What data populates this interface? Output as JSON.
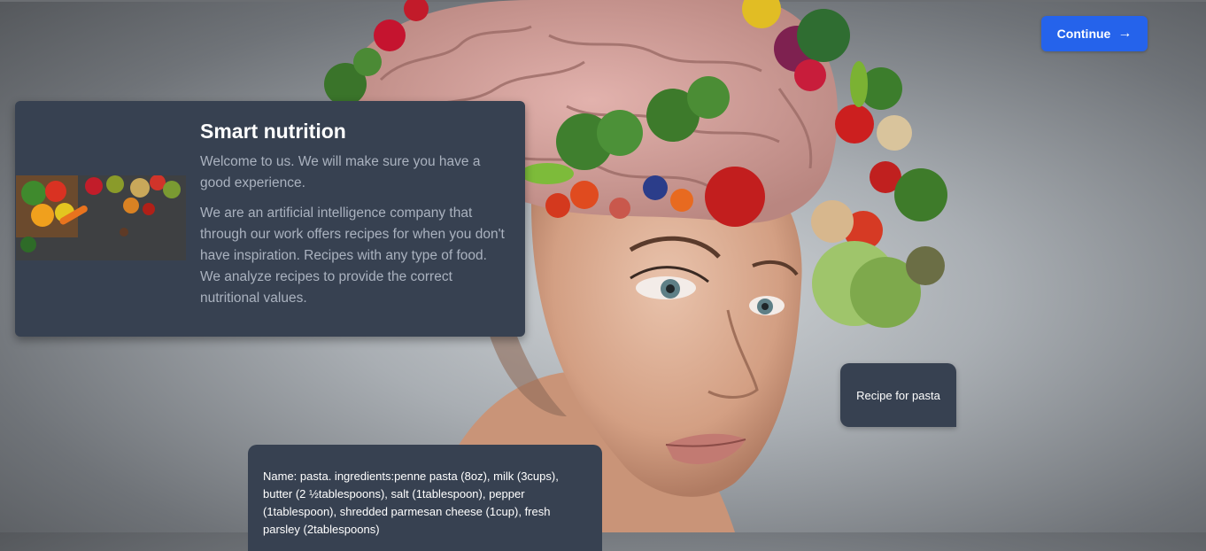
{
  "header": {
    "continue_label": "Continue",
    "continue_icon": "arrow-right-icon"
  },
  "intro": {
    "title": "Smart nutrition",
    "paragraph1": "Welcome to us. We will make sure you have a good experience.",
    "paragraph2": "We are an artificial intelligence company that through our work offers recipes for when you don't have inspiration. Recipes with any type of food. We analyze recipes to provide the correct nutritional values."
  },
  "chat": {
    "prompt_label": "Recipe for pasta"
  },
  "recipe": {
    "text": "Name: pasta. ingredients:penne pasta (8oz), milk (3cups), butter (2 ½tablespoons), salt (1tablespoon), pepper (1tablespoon), shredded parmesan cheese (1cup), fresh parsley (2tablespoons)"
  },
  "colors": {
    "accent": "#2563eb",
    "card_bg": "#374151",
    "muted_text": "#aab2bf"
  }
}
